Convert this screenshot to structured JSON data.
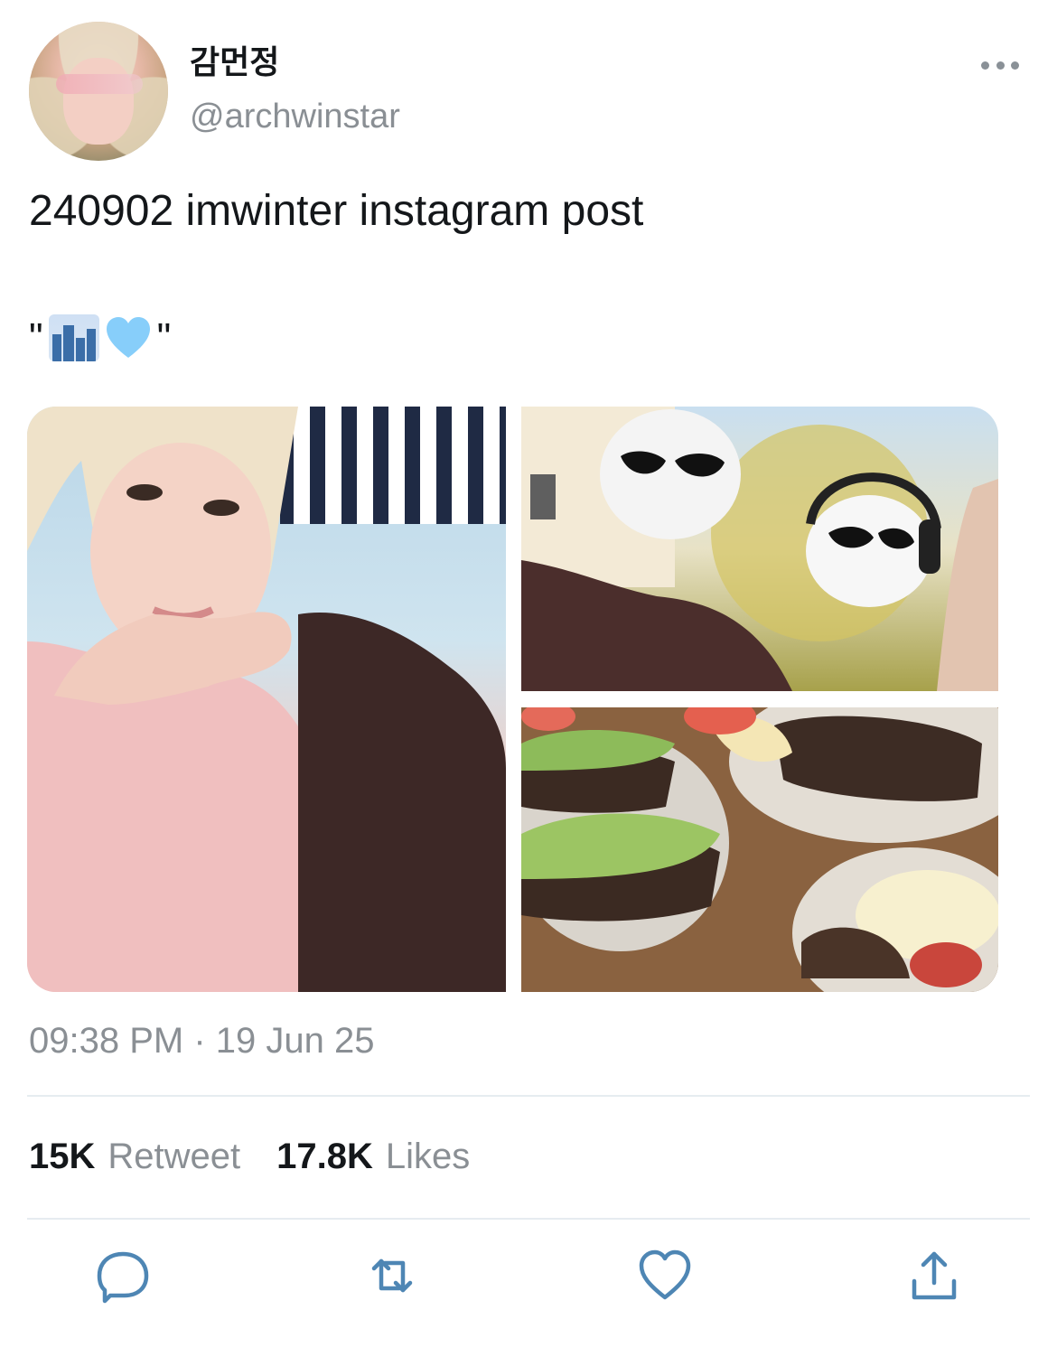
{
  "user": {
    "display_name": "감먼정",
    "handle": "@archwinstar"
  },
  "tweet": {
    "text": "240902 imwinter instagram post",
    "quote_open": "\"",
    "quote_close": "\"",
    "emojis": [
      "cityscape-emoji",
      "light-blue-heart-emoji"
    ]
  },
  "media": {
    "images": [
      {
        "name": "selfie-photo"
      },
      {
        "name": "cats-photo"
      },
      {
        "name": "food-photo"
      }
    ]
  },
  "meta": {
    "timestamp": "09:38 PM · 19 Jun 25"
  },
  "stats": {
    "retweets_count": "15K",
    "retweets_label": "Retweet",
    "likes_count": "17.8K",
    "likes_label": "Likes"
  },
  "actions": [
    "reply-icon",
    "retweet-icon",
    "like-icon",
    "share-icon"
  ],
  "colors": {
    "text": "#14171a",
    "muted": "#8a8f94",
    "divider": "#e6ecf0",
    "heart": "#87cefa"
  }
}
